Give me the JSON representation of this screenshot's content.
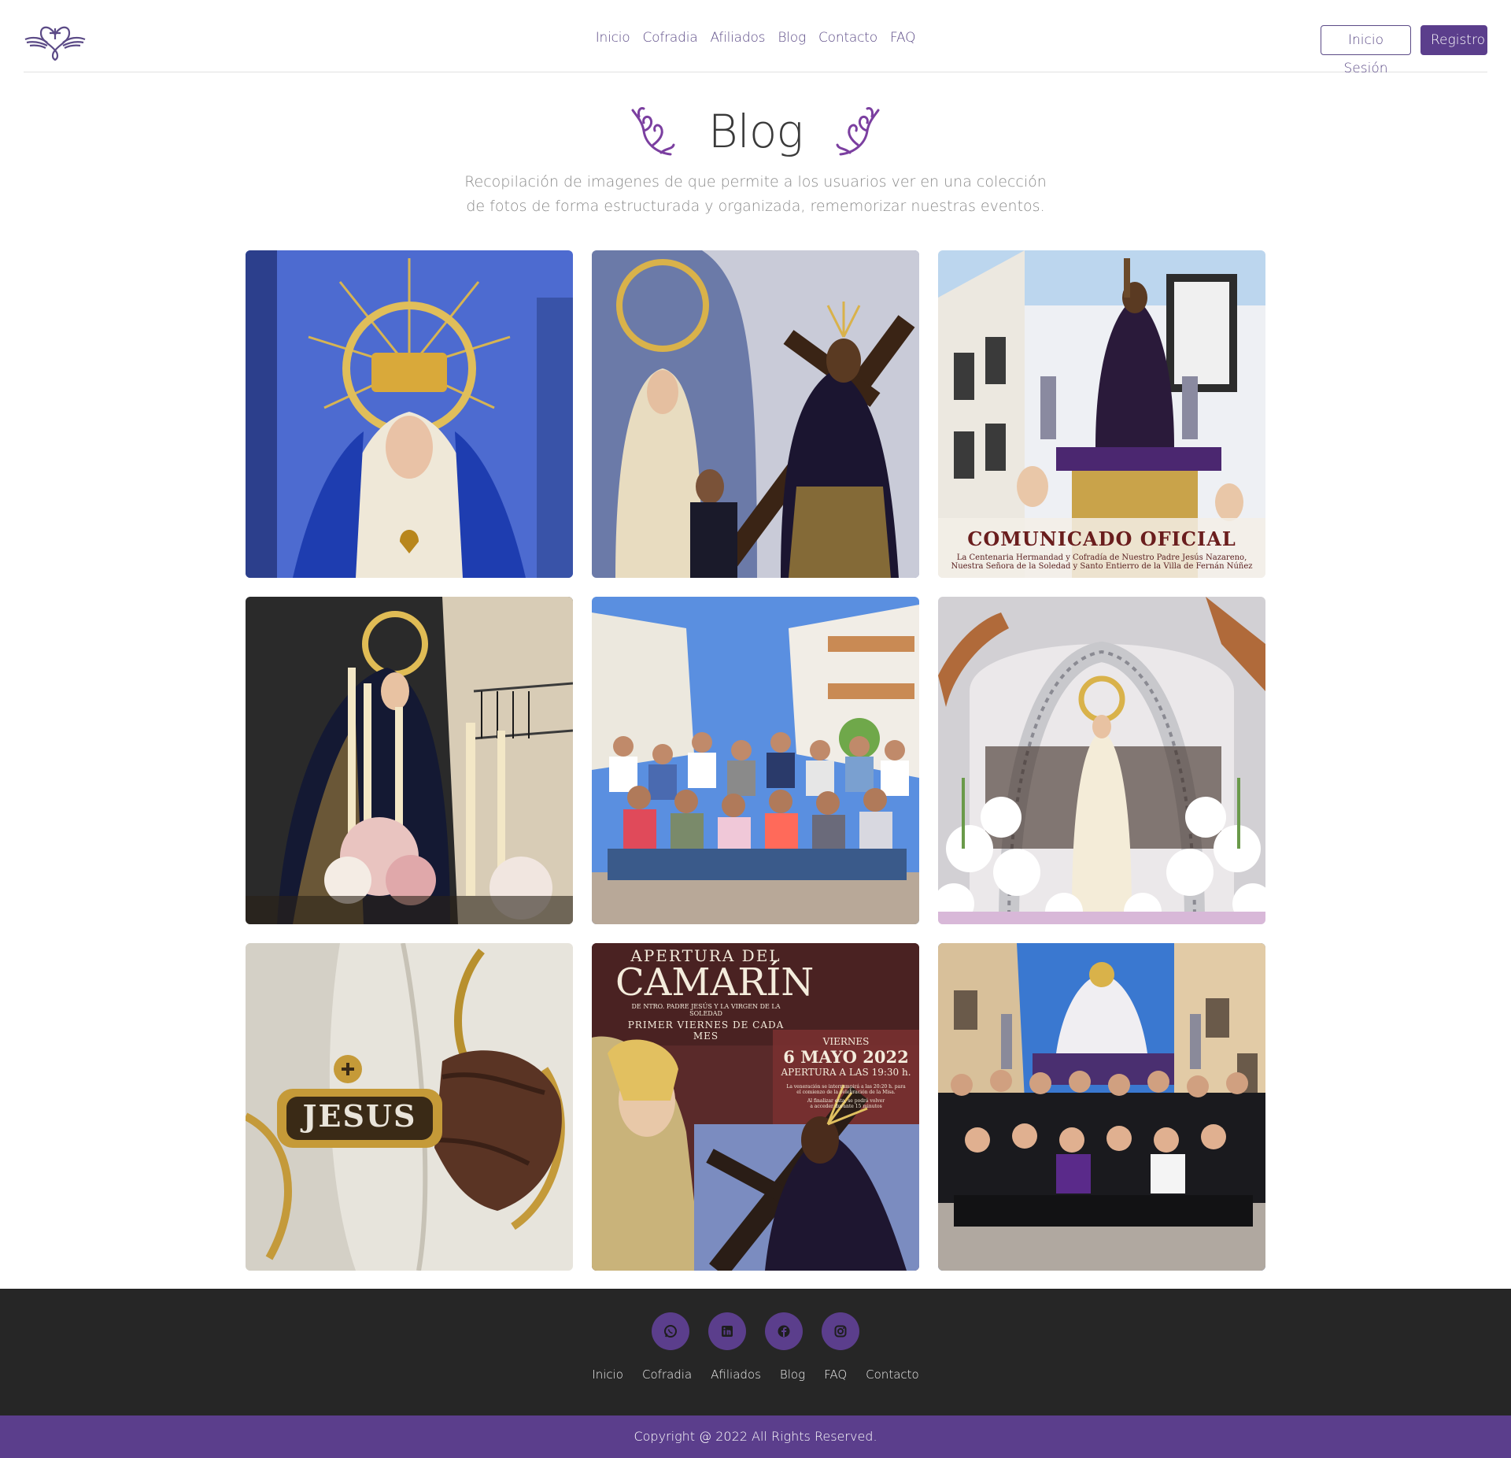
{
  "header": {
    "logo_icon": "brotherhood-heart-cross-logo",
    "nav": [
      "Inicio",
      "Cofradia",
      "Afiliados",
      "Blog",
      "Contacto",
      "FAQ"
    ],
    "login_label": "Inicio Sesión",
    "register_label": "Registro"
  },
  "hero": {
    "title": "Blog",
    "description": "Recopilación de imagenes de que permite a los usuarios ver en una colección de fotos de forma estructurada y organizada, rememorizar nuestras eventos."
  },
  "gallery": {
    "tiles": [
      {
        "text": ""
      },
      {
        "text": ""
      },
      {
        "title": "COMUNICADO OFICIAL",
        "line1": "La Centenaria Hermandad y Cofradía de Nuestro Padre Jesús Nazareno,",
        "line2": "Nuestra Señora de la Soledad y Santo Entierro de la Villa de Fernán Núñez"
      },
      {
        "text": ""
      },
      {
        "text": ""
      },
      {
        "text": ""
      },
      {
        "badge": "JESUS"
      },
      {
        "line1": "APERTURA DEL",
        "line2": "CAMARÍN",
        "line3": "DE NTRO. PADRE JESÚS Y LA VIRGEN DE LA SOLEDAD",
        "line4": "PRIMER VIERNES DE CADA MES",
        "day": "VIERNES",
        "date": "6 MAYO 2022",
        "time": "APERTURA A LAS 19:30 h.",
        "note1": "La veneración se interrumpirá a las 20:20 h. para",
        "note2": "el comienzo de la celebración de la Misa.",
        "note3": "Al finalizar esta, se podrá volver",
        "note4": "a acceder durante 15 minutos"
      },
      {
        "text": ""
      }
    ]
  },
  "footer": {
    "socials": [
      "whatsapp-icon",
      "linkedin-icon",
      "facebook-icon",
      "instagram-icon"
    ],
    "nav": [
      "Inicio",
      "Cofradia",
      "Afiliados",
      "Blog",
      "FAQ",
      "Contacto"
    ],
    "copyright": "Copyright @ 2022 All Rights Reserved."
  },
  "colors": {
    "brand": "#5b3e8c",
    "footer_bg": "#262626"
  }
}
